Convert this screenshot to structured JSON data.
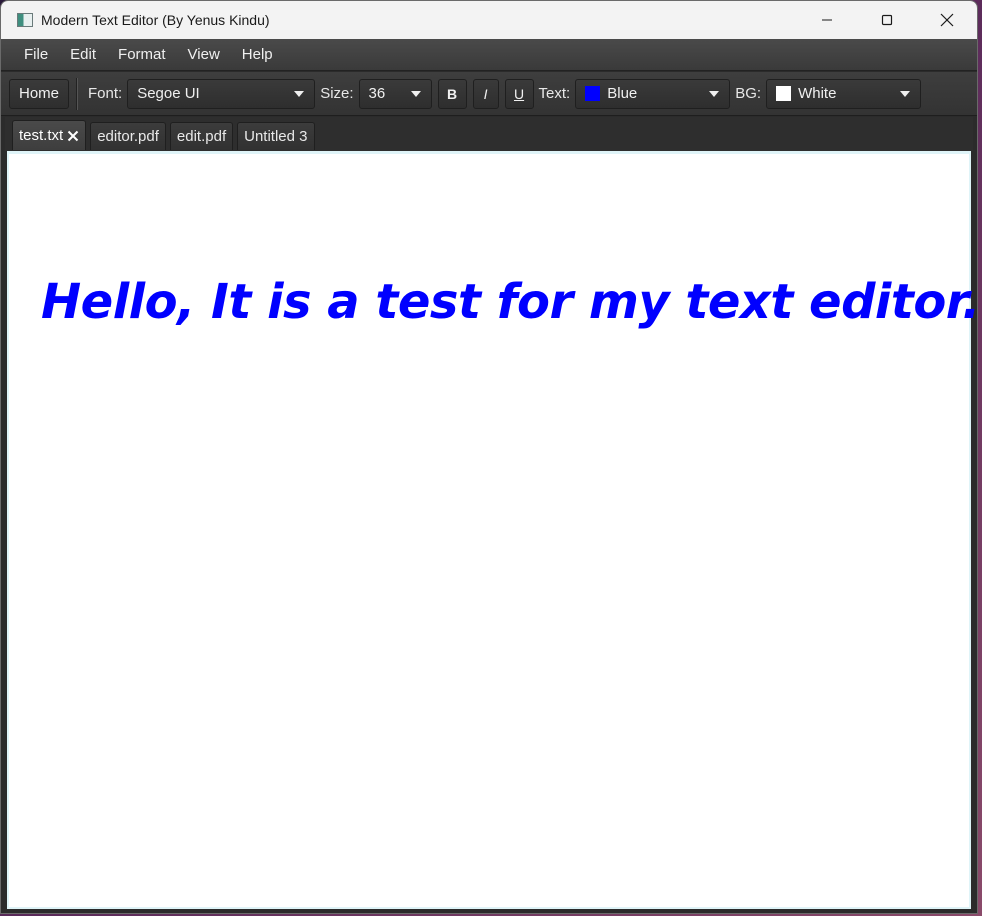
{
  "window": {
    "title": "Modern Text Editor (By Yenus Kindu)"
  },
  "menubar": {
    "items": [
      "File",
      "Edit",
      "Format",
      "View",
      "Help"
    ]
  },
  "toolbar": {
    "home_label": "Home",
    "font_label": "Font:",
    "font_value": "Segoe UI",
    "size_label": "Size:",
    "size_value": "36",
    "bold_label": "B",
    "italic_label": "I",
    "underline_label": "U",
    "text_label": "Text:",
    "text_color_value": "Blue",
    "text_color_hex": "#0000ff",
    "bg_label": "BG:",
    "bg_color_value": "White",
    "bg_color_hex": "#ffffff"
  },
  "tabs": [
    {
      "label": "test.txt",
      "active": true
    },
    {
      "label": "editor.pdf",
      "active": false
    },
    {
      "label": "edit.pdf",
      "active": false
    },
    {
      "label": "Untitled 3",
      "active": false
    }
  ],
  "editor": {
    "content": "Hello, It is a test for my text editor..."
  }
}
